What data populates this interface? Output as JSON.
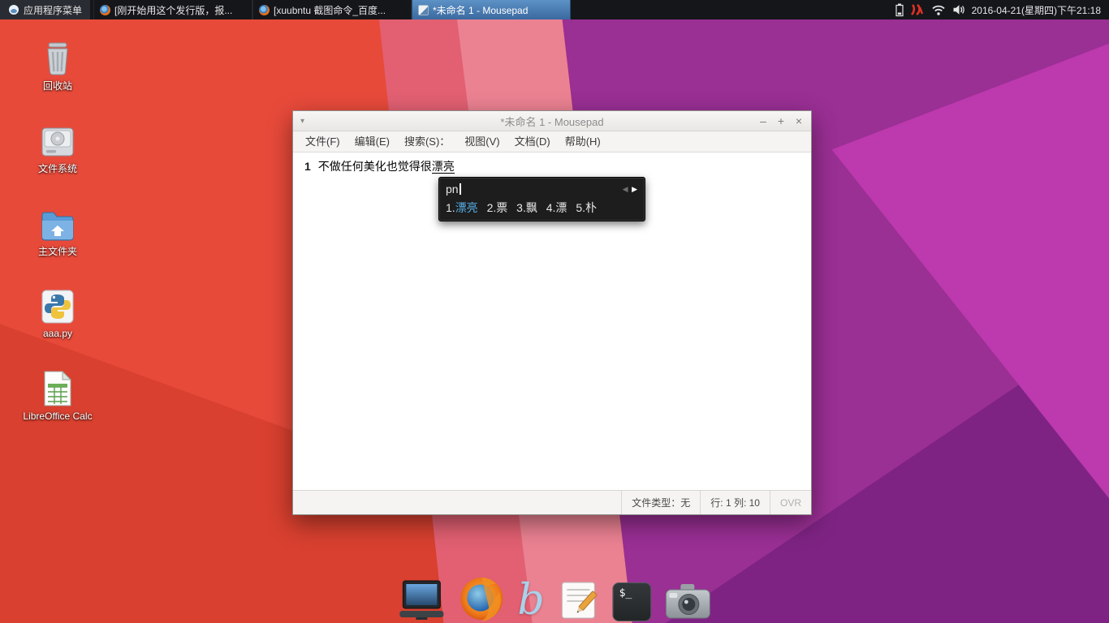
{
  "panel": {
    "app_menu": "应用程序菜单",
    "tasks": [
      {
        "label": "[刚开始用这个发行版，报..."
      },
      {
        "label": "[xuubntu 截图命令_百度..."
      },
      {
        "label": "*未命名 1 - Mousepad"
      }
    ],
    "clock": "2016-04-21(星期四)下午21:18"
  },
  "desktop_icons": [
    {
      "label": "回收站"
    },
    {
      "label": "文件系统"
    },
    {
      "label": "主文件夹"
    },
    {
      "label": "aaa.py"
    },
    {
      "label": "LibreOffice Calc"
    }
  ],
  "window": {
    "title": "*未命名 1 - Mousepad",
    "menus": [
      "文件(F)",
      "编辑(E)",
      "搜索(S)：",
      "视图(V)",
      "文档(D)",
      "帮助(H)"
    ],
    "line_number": "1",
    "text": "不做任何美化也觉得很",
    "preedit": "漂亮",
    "status": {
      "filetype": "文件类型：无",
      "position": "行: 1 列: 10",
      "mode": "OVR"
    }
  },
  "ime": {
    "input": "pn",
    "candidates": [
      {
        "num": "1.",
        "text": "漂亮"
      },
      {
        "num": "2.",
        "text": "票"
      },
      {
        "num": "3.",
        "text": "飘"
      },
      {
        "num": "4.",
        "text": "漂"
      },
      {
        "num": "5.",
        "text": "朴"
      }
    ]
  },
  "icons": {
    "window_menu": "▾",
    "minimize": "–",
    "maximize": "+",
    "close": "×",
    "ime_prev": "◀",
    "ime_next": "▶",
    "terminal_glyph": "$_",
    "bing_glyph": "b"
  },
  "colors": {
    "task_active": "#3a699f",
    "ime_highlight": "#57b0e8",
    "wallpaper_red": "#e84a3a",
    "wallpaper_purple": "#9a2f94"
  }
}
